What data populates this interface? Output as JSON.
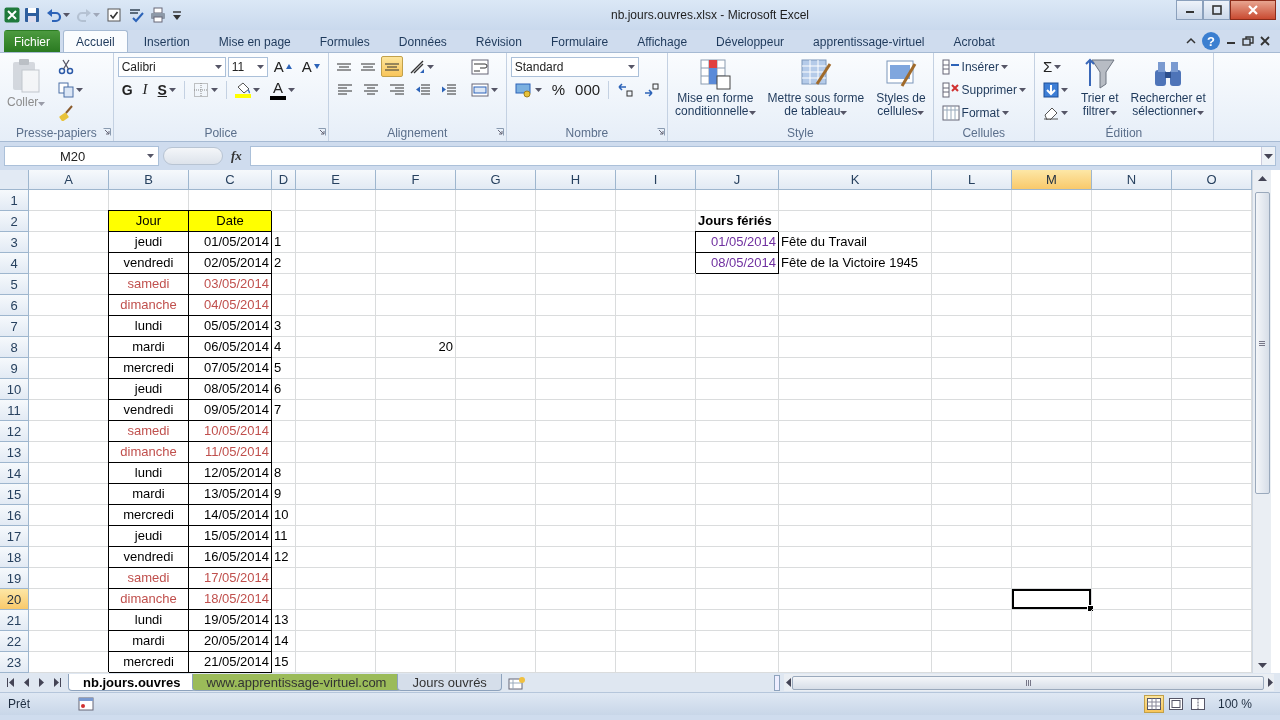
{
  "window": {
    "title": "nb.jours.ouvres.xlsx - Microsoft Excel"
  },
  "quick_access": [
    {
      "kind": "save",
      "disabled": false,
      "dropdown": false
    },
    {
      "kind": "undo",
      "disabled": false,
      "dropdown": true
    },
    {
      "kind": "redo",
      "disabled": true,
      "dropdown": true
    },
    {
      "kind": "checkbox",
      "disabled": false,
      "dropdown": false
    },
    {
      "kind": "spelling",
      "disabled": false,
      "dropdown": false
    },
    {
      "kind": "print",
      "disabled": false,
      "dropdown": false
    },
    {
      "kind": "customize",
      "disabled": false,
      "dropdown": false
    }
  ],
  "ribbon_tabs": [
    {
      "label": "Fichier",
      "kind": "file",
      "selected": false
    },
    {
      "label": "Accueil",
      "kind": "tab",
      "selected": true
    },
    {
      "label": "Insertion",
      "kind": "tab",
      "selected": false
    },
    {
      "label": "Mise en page",
      "kind": "tab",
      "selected": false
    },
    {
      "label": "Formules",
      "kind": "tab",
      "selected": false
    },
    {
      "label": "Données",
      "kind": "tab",
      "selected": false
    },
    {
      "label": "Révision",
      "kind": "tab",
      "selected": false
    },
    {
      "label": "Formulaire",
      "kind": "tab",
      "selected": false
    },
    {
      "label": "Affichage",
      "kind": "tab",
      "selected": false
    },
    {
      "label": "Développeur",
      "kind": "tab",
      "selected": false
    },
    {
      "label": "apprentissage-virtuel",
      "kind": "tab",
      "selected": false
    },
    {
      "label": "Acrobat",
      "kind": "tab",
      "selected": false
    }
  ],
  "help": "?",
  "groups": [
    {
      "name": "Presse-papiers",
      "launcher": true,
      "columns": [
        {
          "kind": "paste",
          "lines": [
            "Coller"
          ],
          "dropdown": true,
          "disabled": true
        },
        {
          "rows": [
            {
              "controls": [
                {
                  "kind": "scissors"
                }
              ]
            },
            {
              "controls": [
                {
                  "kind": "copy",
                  "dropdown": true
                }
              ]
            },
            {
              "controls": [
                {
                  "kind": "brush"
                }
              ]
            }
          ]
        }
      ]
    },
    {
      "name": "Police",
      "launcher": true,
      "columns": [
        {
          "rows": [
            {
              "controls": [
                {
                  "kind": "font-field",
                  "value": "Calibri"
                },
                {
                  "kind": "size-field",
                  "value": "11"
                },
                {
                  "kind": "grow",
                  "label": "A"
                },
                {
                  "kind": "shrink",
                  "label": "A"
                }
              ]
            },
            {
              "controls": [
                {
                  "kind": "bold",
                  "label": "G"
                },
                {
                  "kind": "italic",
                  "label": "I"
                },
                {
                  "kind": "underline",
                  "label": "S",
                  "dropdown": true
                },
                {
                  "kind": "separator"
                },
                {
                  "kind": "borders",
                  "dropdown": true
                },
                {
                  "kind": "separator"
                },
                {
                  "kind": "fill-color",
                  "dropdown": true
                },
                {
                  "kind": "font-color",
                  "label": "A",
                  "dropdown": true
                }
              ]
            }
          ]
        }
      ]
    },
    {
      "name": "Alignement",
      "launcher": true,
      "columns": [
        {
          "rows": [
            {
              "controls": [
                {
                  "kind": "align-top",
                  "selected": false
                },
                {
                  "kind": "align-middle",
                  "selected": false
                },
                {
                  "kind": "align-bottom",
                  "selected": true
                },
                {
                  "kind": "orientation",
                  "dropdown": true
                }
              ]
            },
            {
              "controls": [
                {
                  "kind": "align-left",
                  "selected": false
                },
                {
                  "kind": "align-center",
                  "selected": false
                },
                {
                  "kind": "align-right",
                  "selected": false
                },
                {
                  "kind": "indent-decrease"
                },
                {
                  "kind": "indent-increase"
                }
              ]
            }
          ]
        },
        {
          "rows": [
            {
              "controls": [
                {
                  "kind": "wrap"
                }
              ]
            },
            {
              "controls": [
                {
                  "kind": "merge",
                  "dropdown": true
                }
              ]
            }
          ]
        }
      ]
    },
    {
      "name": "Nombre",
      "launcher": true,
      "columns": [
        {
          "rows": [
            {
              "controls": [
                {
                  "kind": "format-field",
                  "value": "Standard"
                }
              ]
            },
            {
              "controls": [
                {
                  "kind": "currency",
                  "dropdown": true
                },
                {
                  "kind": "percent",
                  "label": "%"
                },
                {
                  "kind": "thousands",
                  "label": "000"
                },
                {
                  "kind": "separator"
                },
                {
                  "kind": "decimal-increase"
                },
                {
                  "kind": "decimal-decrease"
                }
              ]
            }
          ]
        }
      ]
    },
    {
      "name": "Style",
      "launcher": false,
      "columns": [
        {
          "kind": "conditional",
          "lines": [
            "Mise en forme",
            "conditionnelle"
          ],
          "dropdown": true,
          "disabled": false
        },
        {
          "kind": "table-format",
          "lines": [
            "Mettre sous forme",
            "de tableau"
          ],
          "dropdown": true,
          "disabled": false
        },
        {
          "kind": "cell-styles",
          "lines": [
            "Styles de",
            "cellules"
          ],
          "dropdown": true,
          "disabled": false
        }
      ]
    },
    {
      "name": "Cellules",
      "launcher": false,
      "columns": [
        {
          "rows": [
            {
              "controls": [
                {
                  "kind": "insert",
                  "label": "Insérer",
                  "dropdown": true
                }
              ]
            },
            {
              "controls": [
                {
                  "kind": "delete",
                  "label": "Supprimer",
                  "dropdown": true
                }
              ]
            },
            {
              "controls": [
                {
                  "kind": "format",
                  "label": "Format",
                  "dropdown": true
                }
              ]
            }
          ]
        }
      ]
    },
    {
      "name": "Édition",
      "launcher": false,
      "columns": [
        {
          "rows": [
            {
              "controls": [
                {
                  "kind": "sum",
                  "label": "Σ",
                  "dropdown": true
                }
              ]
            },
            {
              "controls": [
                {
                  "kind": "fill-down",
                  "dropdown": true
                }
              ]
            },
            {
              "controls": [
                {
                  "kind": "eraser",
                  "dropdown": true
                }
              ]
            }
          ]
        },
        {
          "kind": "sort-filter",
          "lines": [
            "Trier et",
            "filtrer"
          ],
          "dropdown": true,
          "disabled": false
        },
        {
          "kind": "binoculars",
          "lines": [
            "Rechercher et",
            "sélectionner"
          ],
          "dropdown": true,
          "disabled": false
        }
      ]
    }
  ],
  "formula_bar": {
    "name_box": "M20",
    "fx": "fx"
  },
  "sheet": {
    "columns": [
      {
        "label": "A",
        "selected": false
      },
      {
        "label": "B",
        "selected": false
      },
      {
        "label": "C",
        "selected": false
      },
      {
        "label": "D",
        "selected": false
      },
      {
        "label": "E",
        "selected": false
      },
      {
        "label": "F",
        "selected": false
      },
      {
        "label": "G",
        "selected": false
      },
      {
        "label": "H",
        "selected": false
      },
      {
        "label": "I",
        "selected": false
      },
      {
        "label": "J",
        "selected": false
      },
      {
        "label": "K",
        "selected": false
      },
      {
        "label": "L",
        "selected": false
      },
      {
        "label": "M",
        "selected": true
      },
      {
        "label": "N",
        "selected": false
      },
      {
        "label": "O",
        "selected": false
      }
    ],
    "rows": [
      {
        "label": "1",
        "selected": false,
        "cells": []
      },
      {
        "label": "2",
        "selected": false,
        "cells": [
          "",
          {
            "text": "Jour",
            "kind": "header"
          },
          {
            "text": "Date",
            "kind": "header"
          },
          "",
          "",
          "",
          "",
          "",
          "",
          {
            "text": "Jours fériés",
            "kind": "title"
          }
        ]
      },
      {
        "label": "3",
        "selected": false,
        "cells": [
          "",
          {
            "text": "jeudi",
            "kind": "day",
            "weekend": false
          },
          {
            "text": "01/05/2014",
            "kind": "date",
            "weekend": false
          },
          {
            "text": "1",
            "kind": "number"
          },
          "",
          "",
          "",
          "",
          "",
          {
            "text": "01/05/2014",
            "kind": "holiday-date"
          },
          {
            "text": "Fête du Travail",
            "kind": "text"
          }
        ]
      },
      {
        "label": "4",
        "selected": false,
        "cells": [
          "",
          {
            "text": "vendredi",
            "kind": "day",
            "weekend": false
          },
          {
            "text": "02/05/2014",
            "kind": "date",
            "weekend": false
          },
          {
            "text": "2",
            "kind": "number"
          },
          "",
          "",
          "",
          "",
          "",
          {
            "text": "08/05/2014",
            "kind": "holiday-date"
          },
          {
            "text": "Fête de la Victoire 1945",
            "kind": "text"
          }
        ]
      },
      {
        "label": "5",
        "selected": false,
        "cells": [
          "",
          {
            "text": "samedi",
            "kind": "day",
            "weekend": true
          },
          {
            "text": "03/05/2014",
            "kind": "date",
            "weekend": true
          }
        ]
      },
      {
        "label": "6",
        "selected": false,
        "cells": [
          "",
          {
            "text": "dimanche",
            "kind": "day",
            "weekend": true
          },
          {
            "text": "04/05/2014",
            "kind": "date",
            "weekend": true
          }
        ]
      },
      {
        "label": "7",
        "selected": false,
        "cells": [
          "",
          {
            "text": "lundi",
            "kind": "day",
            "weekend": false
          },
          {
            "text": "05/05/2014",
            "kind": "date",
            "weekend": false
          },
          {
            "text": "3",
            "kind": "number"
          }
        ]
      },
      {
        "label": "8",
        "selected": false,
        "cells": [
          "",
          {
            "text": "mardi",
            "kind": "day",
            "weekend": false
          },
          {
            "text": "06/05/2014",
            "kind": "date",
            "weekend": false
          },
          {
            "text": "4",
            "kind": "number"
          },
          "",
          {
            "text": "20",
            "kind": "value"
          }
        ]
      },
      {
        "label": "9",
        "selected": false,
        "cells": [
          "",
          {
            "text": "mercredi",
            "kind": "day",
            "weekend": false
          },
          {
            "text": "07/05/2014",
            "kind": "date",
            "weekend": false
          },
          {
            "text": "5",
            "kind": "number"
          }
        ]
      },
      {
        "label": "10",
        "selected": false,
        "cells": [
          "",
          {
            "text": "jeudi",
            "kind": "day",
            "weekend": false
          },
          {
            "text": "08/05/2014",
            "kind": "date",
            "weekend": false
          },
          {
            "text": "6",
            "kind": "number"
          }
        ]
      },
      {
        "label": "11",
        "selected": false,
        "cells": [
          "",
          {
            "text": "vendredi",
            "kind": "day",
            "weekend": false
          },
          {
            "text": "09/05/2014",
            "kind": "date",
            "weekend": false
          },
          {
            "text": "7",
            "kind": "number"
          }
        ]
      },
      {
        "label": "12",
        "selected": false,
        "cells": [
          "",
          {
            "text": "samedi",
            "kind": "day",
            "weekend": true
          },
          {
            "text": "10/05/2014",
            "kind": "date",
            "weekend": true
          }
        ]
      },
      {
        "label": "13",
        "selected": false,
        "cells": [
          "",
          {
            "text": "dimanche",
            "kind": "day",
            "weekend": true
          },
          {
            "text": "11/05/2014",
            "kind": "date",
            "weekend": true
          }
        ]
      },
      {
        "label": "14",
        "selected": false,
        "cells": [
          "",
          {
            "text": "lundi",
            "kind": "day",
            "weekend": false
          },
          {
            "text": "12/05/2014",
            "kind": "date",
            "weekend": false
          },
          {
            "text": "8",
            "kind": "number"
          }
        ]
      },
      {
        "label": "15",
        "selected": false,
        "cells": [
          "",
          {
            "text": "mardi",
            "kind": "day",
            "weekend": false
          },
          {
            "text": "13/05/2014",
            "kind": "date",
            "weekend": false
          },
          {
            "text": "9",
            "kind": "number"
          }
        ]
      },
      {
        "label": "16",
        "selected": false,
        "cells": [
          "",
          {
            "text": "mercredi",
            "kind": "day",
            "weekend": false
          },
          {
            "text": "14/05/2014",
            "kind": "date",
            "weekend": false
          },
          {
            "text": "10",
            "kind": "number"
          }
        ]
      },
      {
        "label": "17",
        "selected": false,
        "cells": [
          "",
          {
            "text": "jeudi",
            "kind": "day",
            "weekend": false
          },
          {
            "text": "15/05/2014",
            "kind": "date",
            "weekend": false
          },
          {
            "text": "11",
            "kind": "number"
          }
        ]
      },
      {
        "label": "18",
        "selected": false,
        "cells": [
          "",
          {
            "text": "vendredi",
            "kind": "day",
            "weekend": false
          },
          {
            "text": "16/05/2014",
            "kind": "date",
            "weekend": false
          },
          {
            "text": "12",
            "kind": "number"
          }
        ]
      },
      {
        "label": "19",
        "selected": false,
        "cells": [
          "",
          {
            "text": "samedi",
            "kind": "day",
            "weekend": true
          },
          {
            "text": "17/05/2014",
            "kind": "date",
            "weekend": true
          }
        ]
      },
      {
        "label": "20",
        "selected": true,
        "cells": [
          "",
          {
            "text": "dimanche",
            "kind": "day",
            "weekend": true
          },
          {
            "text": "18/05/2014",
            "kind": "date",
            "weekend": true
          }
        ]
      },
      {
        "label": "21",
        "selected": false,
        "cells": [
          "",
          {
            "text": "lundi",
            "kind": "day",
            "weekend": false
          },
          {
            "text": "19/05/2014",
            "kind": "date",
            "weekend": false
          },
          {
            "text": "13",
            "kind": "number"
          }
        ]
      },
      {
        "label": "22",
        "selected": false,
        "cells": [
          "",
          {
            "text": "mardi",
            "kind": "day",
            "weekend": false
          },
          {
            "text": "20/05/2014",
            "kind": "date",
            "weekend": false
          },
          {
            "text": "14",
            "kind": "number"
          }
        ]
      },
      {
        "label": "23",
        "selected": false,
        "cells": [
          "",
          {
            "text": "mercredi",
            "kind": "day",
            "weekend": false
          },
          {
            "text": "21/05/2014",
            "kind": "date",
            "weekend": false
          },
          {
            "text": "15",
            "kind": "number"
          }
        ]
      }
    ]
  },
  "sheet_tabs": [
    {
      "label": "nb.jours.ouvres",
      "selected": true
    },
    {
      "label": "www.apprentissage-virtuel.com",
      "selected": false,
      "color": "#9bbb59"
    },
    {
      "label": "Jours ouvrés",
      "selected": false
    }
  ],
  "status_bar": {
    "text": "Prêt",
    "views": [
      {
        "kind": "normal",
        "selected": true
      },
      {
        "kind": "layout",
        "selected": false
      },
      {
        "kind": "break",
        "selected": false
      }
    ],
    "zoom": "100 %"
  }
}
